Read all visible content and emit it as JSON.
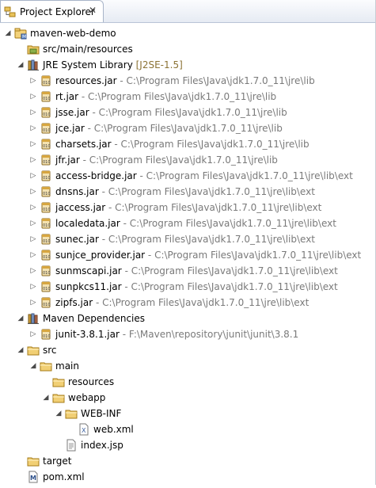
{
  "view_tab": {
    "title": "Project Explorer",
    "icon": "project-explorer-icon",
    "close": "close-icon"
  },
  "tree": [
    {
      "depth": 0,
      "expanded": true,
      "icon": "project",
      "label": "maven-web-demo",
      "decoration": ""
    },
    {
      "depth": 1,
      "expanded": null,
      "icon": "srcfolder",
      "label": "src/main/resources",
      "decoration": ""
    },
    {
      "depth": 1,
      "expanded": true,
      "icon": "library",
      "label": "JRE System Library",
      "decoration": "[J2SE-1.5]"
    },
    {
      "depth": 2,
      "expanded": false,
      "icon": "jar",
      "label": "resources.jar",
      "decoration": " - C:\\Program Files\\Java\\jdk1.7.0_11\\jre\\lib"
    },
    {
      "depth": 2,
      "expanded": false,
      "icon": "jar",
      "label": "rt.jar",
      "decoration": " - C:\\Program Files\\Java\\jdk1.7.0_11\\jre\\lib"
    },
    {
      "depth": 2,
      "expanded": false,
      "icon": "jar",
      "label": "jsse.jar",
      "decoration": " - C:\\Program Files\\Java\\jdk1.7.0_11\\jre\\lib"
    },
    {
      "depth": 2,
      "expanded": false,
      "icon": "jar",
      "label": "jce.jar",
      "decoration": " - C:\\Program Files\\Java\\jdk1.7.0_11\\jre\\lib"
    },
    {
      "depth": 2,
      "expanded": false,
      "icon": "jar",
      "label": "charsets.jar",
      "decoration": " - C:\\Program Files\\Java\\jdk1.7.0_11\\jre\\lib"
    },
    {
      "depth": 2,
      "expanded": false,
      "icon": "jar",
      "label": "jfr.jar",
      "decoration": " - C:\\Program Files\\Java\\jdk1.7.0_11\\jre\\lib"
    },
    {
      "depth": 2,
      "expanded": false,
      "icon": "jar",
      "label": "access-bridge.jar",
      "decoration": " - C:\\Program Files\\Java\\jdk1.7.0_11\\jre\\lib\\ext"
    },
    {
      "depth": 2,
      "expanded": false,
      "icon": "jar",
      "label": "dnsns.jar",
      "decoration": " - C:\\Program Files\\Java\\jdk1.7.0_11\\jre\\lib\\ext"
    },
    {
      "depth": 2,
      "expanded": false,
      "icon": "jar",
      "label": "jaccess.jar",
      "decoration": " - C:\\Program Files\\Java\\jdk1.7.0_11\\jre\\lib\\ext"
    },
    {
      "depth": 2,
      "expanded": false,
      "icon": "jar",
      "label": "localedata.jar",
      "decoration": " - C:\\Program Files\\Java\\jdk1.7.0_11\\jre\\lib\\ext"
    },
    {
      "depth": 2,
      "expanded": false,
      "icon": "jar",
      "label": "sunec.jar",
      "decoration": " - C:\\Program Files\\Java\\jdk1.7.0_11\\jre\\lib\\ext"
    },
    {
      "depth": 2,
      "expanded": false,
      "icon": "jar",
      "label": "sunjce_provider.jar",
      "decoration": " - C:\\Program Files\\Java\\jdk1.7.0_11\\jre\\lib\\ext"
    },
    {
      "depth": 2,
      "expanded": false,
      "icon": "jar",
      "label": "sunmscapi.jar",
      "decoration": " - C:\\Program Files\\Java\\jdk1.7.0_11\\jre\\lib\\ext"
    },
    {
      "depth": 2,
      "expanded": false,
      "icon": "jar",
      "label": "sunpkcs11.jar",
      "decoration": " - C:\\Program Files\\Java\\jdk1.7.0_11\\jre\\lib\\ext"
    },
    {
      "depth": 2,
      "expanded": false,
      "icon": "jar",
      "label": "zipfs.jar",
      "decoration": " - C:\\Program Files\\Java\\jdk1.7.0_11\\jre\\lib\\ext"
    },
    {
      "depth": 1,
      "expanded": true,
      "icon": "library",
      "label": "Maven Dependencies",
      "decoration": ""
    },
    {
      "depth": 2,
      "expanded": false,
      "icon": "jar",
      "label": "junit-3.8.1.jar",
      "decoration": " - F:\\Maven\\repository\\junit\\junit\\3.8.1"
    },
    {
      "depth": 1,
      "expanded": true,
      "icon": "folder",
      "label": "src",
      "decoration": ""
    },
    {
      "depth": 2,
      "expanded": true,
      "icon": "folder",
      "label": "main",
      "decoration": ""
    },
    {
      "depth": 3,
      "expanded": null,
      "icon": "folder",
      "label": "resources",
      "decoration": ""
    },
    {
      "depth": 3,
      "expanded": true,
      "icon": "folder",
      "label": "webapp",
      "decoration": ""
    },
    {
      "depth": 4,
      "expanded": true,
      "icon": "folder",
      "label": "WEB-INF",
      "decoration": ""
    },
    {
      "depth": 5,
      "expanded": null,
      "icon": "xml",
      "label": "web.xml",
      "decoration": ""
    },
    {
      "depth": 4,
      "expanded": null,
      "icon": "file",
      "label": "index.jsp",
      "decoration": ""
    },
    {
      "depth": 1,
      "expanded": null,
      "icon": "folder",
      "label": "target",
      "decoration": ""
    },
    {
      "depth": 1,
      "expanded": null,
      "icon": "maven",
      "label": "pom.xml",
      "decoration": ""
    }
  ]
}
